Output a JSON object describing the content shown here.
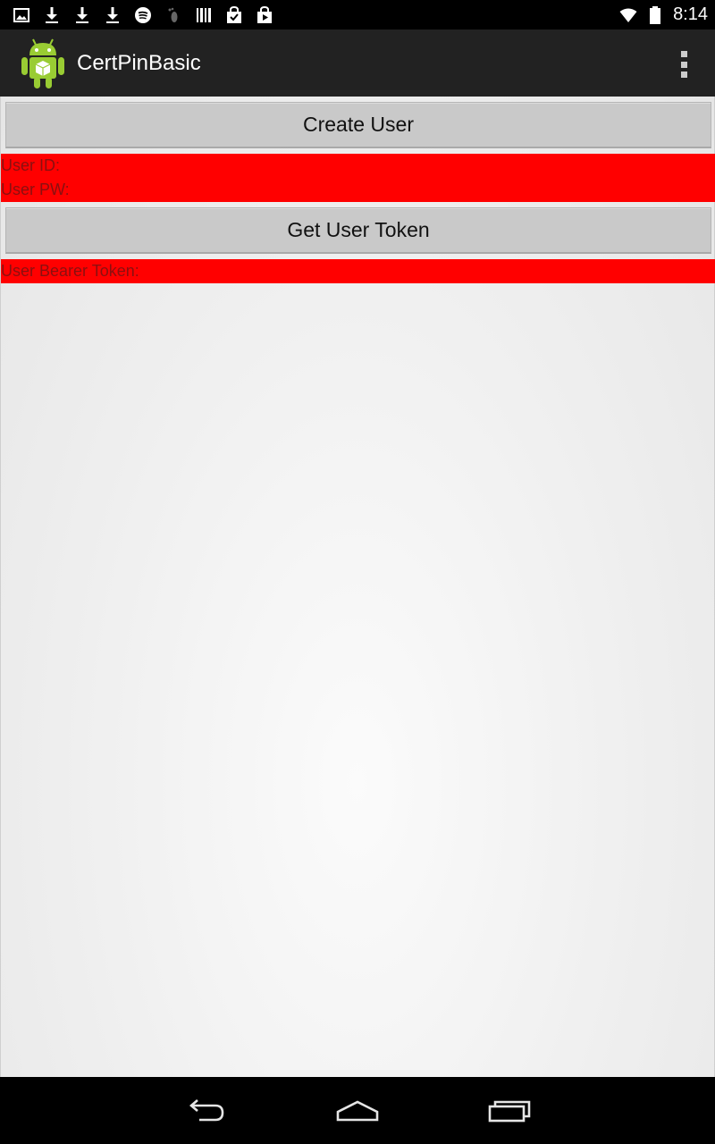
{
  "status_bar": {
    "time": "8:14",
    "left_icons": [
      "image-icon",
      "download-icon",
      "download-icon",
      "download-icon",
      "spotify-icon",
      "foot-icon",
      "barcode-icon",
      "shopping-bag-check-icon",
      "play-store-icon"
    ],
    "right_icons": [
      "wifi-icon",
      "battery-icon"
    ]
  },
  "action_bar": {
    "title": "CertPinBasic",
    "app_icon": "android-robot-icon",
    "overflow_icon": "overflow-menu-icon"
  },
  "main": {
    "create_user_label": "Create User",
    "user_id_label": "User ID:",
    "user_pw_label": "User PW:",
    "get_token_label": "Get User Token",
    "bearer_token_label": "User Bearer Token:"
  },
  "nav_bar": {
    "back_icon": "back-icon",
    "home_icon": "home-icon",
    "recents_icon": "recents-icon"
  },
  "colors": {
    "highlight": "#ff0000",
    "action_bar": "#222222",
    "button": "#c9c9c9"
  }
}
